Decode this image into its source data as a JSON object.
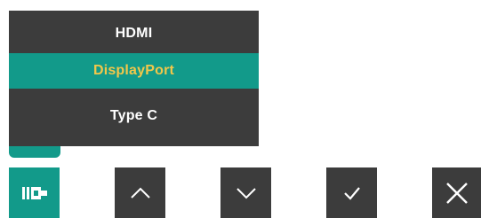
{
  "input_menu": {
    "items": [
      {
        "label": "HDMI",
        "selected": false
      },
      {
        "label": "DisplayPort",
        "selected": true
      },
      {
        "label": "Type C",
        "selected": false
      }
    ],
    "selected_color": "#f2c74a",
    "highlight_color": "#129a8a",
    "background_color": "#3c3c3c"
  },
  "control_keys": [
    {
      "icon": "input-source-icon",
      "active": true
    },
    {
      "icon": "arrow-up-icon",
      "active": false
    },
    {
      "icon": "arrow-down-icon",
      "active": false
    },
    {
      "icon": "checkmark-icon",
      "active": false
    },
    {
      "icon": "close-icon",
      "active": false
    }
  ]
}
